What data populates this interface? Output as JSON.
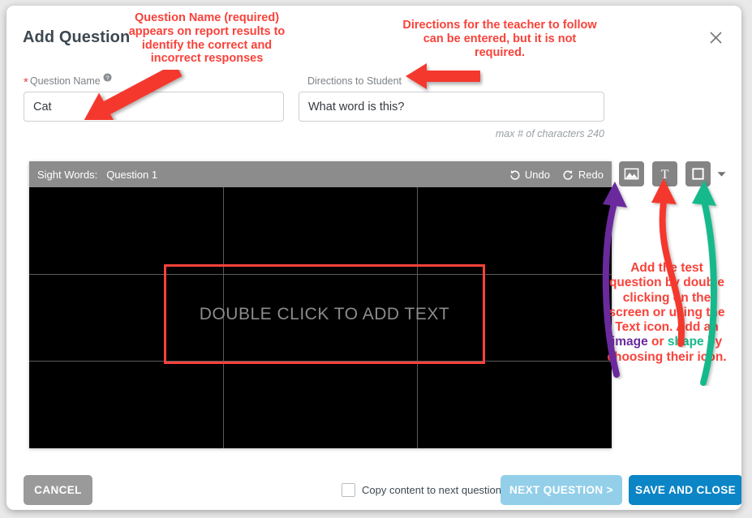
{
  "dialog": {
    "title": "Add Question",
    "close_icon": "close-icon"
  },
  "form": {
    "question_name": {
      "label": "Question Name",
      "required_mark": "*",
      "help_icon": "help-circle-icon",
      "value": "Cat",
      "placeholder": ""
    },
    "directions": {
      "label": "Directions to Student",
      "value": "What word is this?",
      "placeholder": "",
      "hint": "max # of characters 240"
    }
  },
  "canvas": {
    "bar": {
      "title": "Sight Words:",
      "subtitle": "Question 1",
      "undo_label": "Undo",
      "undo_icon": "undo-arrow-icon",
      "redo_label": "Redo",
      "redo_icon": "redo-arrow-icon"
    },
    "placeholder_text": "DOUBLE CLICK TO ADD TEXT",
    "background_color": "#000000",
    "grid_line_color": "#5a5a5a",
    "textbox_border_color": "#f9423a"
  },
  "tools": [
    {
      "name": "image-tool",
      "icon": "image-icon"
    },
    {
      "name": "text-tool",
      "icon": "text-t-icon"
    },
    {
      "name": "shape-tool",
      "icon": "square-shape-icon"
    }
  ],
  "tools_caret_icon": "chevron-down-icon",
  "footer": {
    "cancel_label": "CANCEL",
    "copy_checkbox_label": "Copy content to next question",
    "copy_checkbox_checked": false,
    "next_label": "NEXT QUESTION >",
    "save_label": "SAVE AND CLOSE"
  },
  "annotations": {
    "question_name_note": "Question Name (required) appears on report results to identify the correct and incorrect responses",
    "directions_note": "Directions for the teacher to follow can be entered, but it is not required.",
    "tools_note_part1": "Add the test question by double clicking on the screen or using the Text icon. Add an ",
    "tools_note_image": "image",
    "tools_note_or": " or ",
    "tools_note_shape": "shape",
    "tools_note_part2": " by choosing their icon."
  },
  "colors": {
    "annotation_red": "#f9423a",
    "annotation_purple": "#6a2a9e",
    "annotation_teal": "#17b98c",
    "save_blue": "#0b85c6",
    "next_blue": "#93cfe9",
    "cancel_gray": "#9a9a9a"
  }
}
